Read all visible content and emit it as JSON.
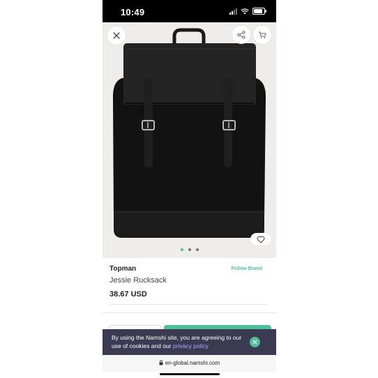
{
  "status_bar": {
    "time": "10:49"
  },
  "product": {
    "brand": "Topman",
    "follow_label": "Follow Brand",
    "name": "Jessie Rucksack",
    "price": "38.67 USD",
    "image_index": 1,
    "image_count": 3
  },
  "cookie_banner": {
    "text": "By using the Namshi site, you are agreeing to our use of cookies and our ",
    "link": "privacy policy"
  },
  "browser": {
    "url": "en-global.namshi.com"
  },
  "icons": {
    "close": "close-icon",
    "share": "share-icon",
    "cart": "cart-icon",
    "wishlist": "heart-icon",
    "lock": "lock-icon"
  },
  "colors": {
    "accent": "#4fbf9a",
    "banner": "#3a3a52",
    "link": "#b7a7ff"
  }
}
